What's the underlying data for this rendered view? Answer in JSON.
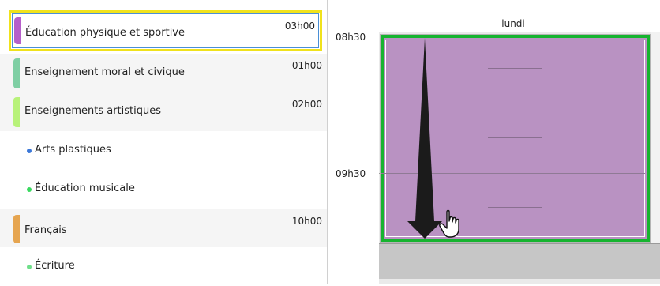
{
  "subjects": [
    {
      "name": "Éducation physique et sportive",
      "duration": "03h00",
      "color": "#b65fca",
      "selected": true
    },
    {
      "name": "Enseignement moral et civique",
      "duration": "01h00",
      "color": "#7fcfa4"
    },
    {
      "name": "Enseignements artistiques",
      "duration": "02h00",
      "color": "#b8f27a"
    },
    {
      "name": "Arts plastiques",
      "dot_color": "#3c78d8"
    },
    {
      "name": "Éducation musicale",
      "dot_color": "#39d95f"
    },
    {
      "name": "Français",
      "duration": "10h00",
      "color": "#e6a550"
    },
    {
      "name": "Écriture",
      "dot_color": "#6fdf8a"
    }
  ],
  "calendar": {
    "day": "lundi",
    "times": [
      "08h30",
      "09h30"
    ],
    "event_color": "#b992c2",
    "event_border_color": "#16b42f"
  },
  "icons": [
    "down-arrow-icon",
    "hand-cursor-icon"
  ]
}
